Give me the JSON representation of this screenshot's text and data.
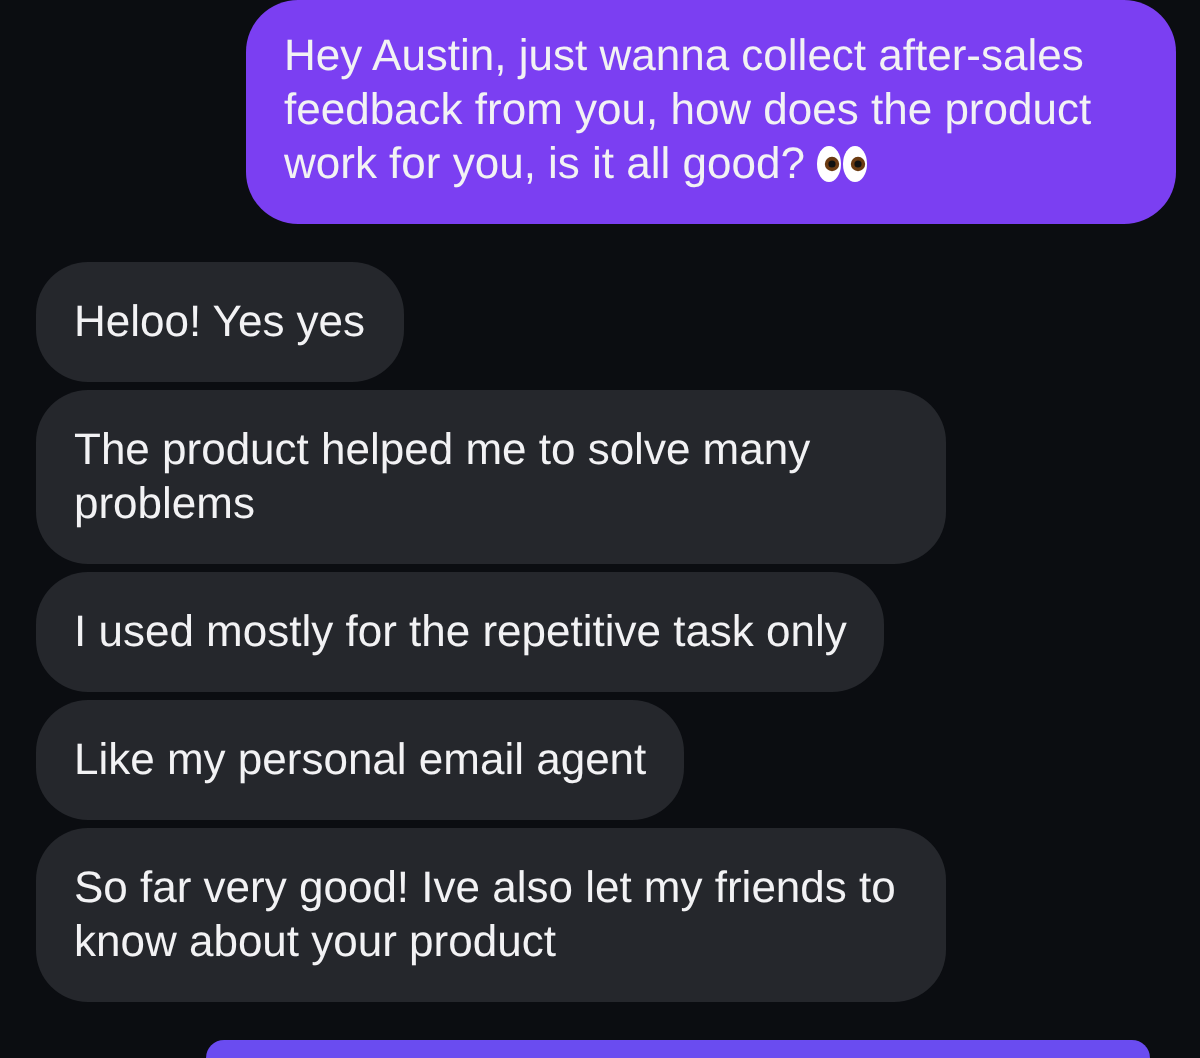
{
  "messages": [
    {
      "kind": "outgoing",
      "text": "Hey Austin, just wanna collect after-sales feedback from you, how does the product work for you, is it all good?",
      "eyes_emoji": true
    },
    {
      "kind": "incoming",
      "text": "Heloo! Yes yes"
    },
    {
      "kind": "incoming",
      "text": "The product helped me to solve many problems"
    },
    {
      "kind": "incoming",
      "text": "I used mostly for the repetitive task only"
    },
    {
      "kind": "incoming",
      "text": "Like my personal email agent"
    },
    {
      "kind": "incoming",
      "text": "So far very good! Ive also let my friends to know about your product"
    },
    {
      "kind": "outgoing"
    }
  ]
}
